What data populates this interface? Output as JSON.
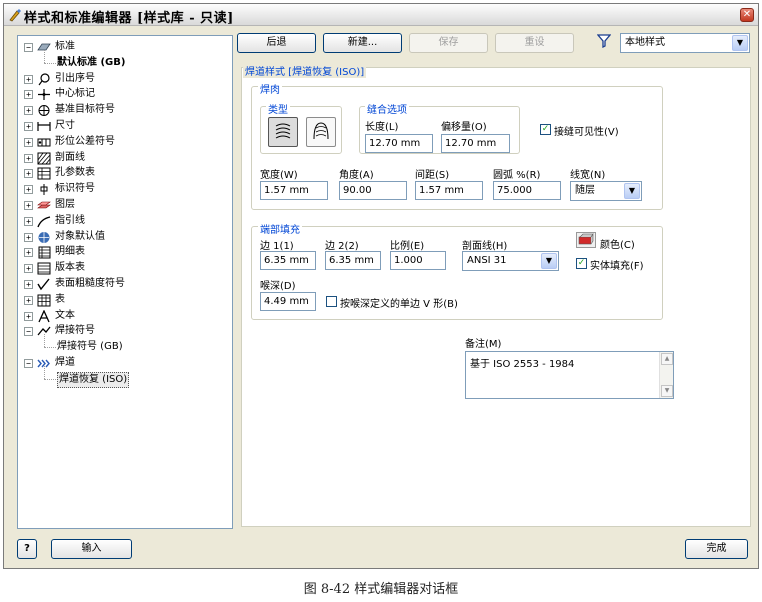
{
  "window": {
    "title": "样式和标准编辑器 [样式库 - 只读]"
  },
  "toolbar": {
    "back": "后退",
    "new": "新建...",
    "save": "保存",
    "reset": "重设",
    "filter_value": "本地样式"
  },
  "tree": [
    {
      "label": "标准",
      "exp": "−",
      "indent": 0,
      "icon": "standard"
    },
    {
      "label": "默认标准 (GB)",
      "exp": "",
      "indent": 1,
      "icon": "",
      "bold": true
    },
    {
      "label": "引出序号",
      "exp": "+",
      "indent": 0,
      "icon": "balloon"
    },
    {
      "label": "中心标记",
      "exp": "+",
      "indent": 0,
      "icon": "center-mark"
    },
    {
      "label": "基准目标符号",
      "exp": "+",
      "indent": 0,
      "icon": "datum-target"
    },
    {
      "label": "尺寸",
      "exp": "+",
      "indent": 0,
      "icon": "dimension"
    },
    {
      "label": "形位公差符号",
      "exp": "+",
      "indent": 0,
      "icon": "gdt"
    },
    {
      "label": "剖面线",
      "exp": "+",
      "indent": 0,
      "icon": "hatch"
    },
    {
      "label": "孔参数表",
      "exp": "+",
      "indent": 0,
      "icon": "hole-table"
    },
    {
      "label": "标识符号",
      "exp": "+",
      "indent": 0,
      "icon": "id-symbol"
    },
    {
      "label": "图层",
      "exp": "+",
      "indent": 0,
      "icon": "layers"
    },
    {
      "label": "指引线",
      "exp": "+",
      "indent": 0,
      "icon": "leader"
    },
    {
      "label": "对象默认值",
      "exp": "+",
      "indent": 0,
      "icon": "object-defaults"
    },
    {
      "label": "明细表",
      "exp": "+",
      "indent": 0,
      "icon": "parts-list"
    },
    {
      "label": "版本表",
      "exp": "+",
      "indent": 0,
      "icon": "revision-table"
    },
    {
      "label": "表面粗糙度符号",
      "exp": "+",
      "indent": 0,
      "icon": "surface-texture"
    },
    {
      "label": "表",
      "exp": "+",
      "indent": 0,
      "icon": "table"
    },
    {
      "label": "文本",
      "exp": "+",
      "indent": 0,
      "icon": "text"
    },
    {
      "label": "焊接符号",
      "exp": "−",
      "indent": 0,
      "icon": "weld-symbol"
    },
    {
      "label": "焊接符号 (GB)",
      "exp": "",
      "indent": 1,
      "icon": ""
    },
    {
      "label": "焊道",
      "exp": "−",
      "indent": 0,
      "icon": "weld-bead"
    },
    {
      "label": "焊道恢复 (ISO)",
      "exp": "",
      "indent": 1,
      "icon": "",
      "selected": true
    }
  ],
  "panel": {
    "title": "焊道样式 [焊道恢复 (ISO)]"
  },
  "weld": {
    "group": "焊肉",
    "type_group": "类型",
    "stitch_group": "缝合选项",
    "length_label": "长度(L)",
    "length_value": "12.70 mm",
    "offset_label": "偏移量(O)",
    "offset_value": "12.70 mm",
    "visible_label": "接缝可见性(V)",
    "visible_checked": true,
    "width_label": "宽度(W)",
    "width_value": "1.57 mm",
    "angle_label": "角度(A)",
    "angle_value": "90.00",
    "spacing_label": "间距(S)",
    "spacing_value": "1.57 mm",
    "arc_label": "圆弧 %(R)",
    "arc_value": "75.000",
    "linewidth_label": "线宽(N)",
    "linewidth_value": "随层"
  },
  "endfill": {
    "group": "端部填充",
    "side1_label": "边 1(1)",
    "side1_value": "6.35 mm",
    "side2_label": "边 2(2)",
    "side2_value": "6.35 mm",
    "ratio_label": "比例(E)",
    "ratio_value": "1.000",
    "hatch_label": "剖面线(H)",
    "hatch_value": "ANSI 31",
    "color_label": "颜色(C)",
    "solid_label": "实体填充(F)",
    "solid_checked": true,
    "depth_label": "喉深(D)",
    "depth_value": "4.49 mm",
    "vshape_label": "按喉深定义的单边 V 形(B)",
    "vshape_checked": false
  },
  "notes": {
    "label": "备注(M)",
    "value": "基于 ISO 2553 - 1984"
  },
  "footer": {
    "help": "?",
    "import": "输入",
    "done": "完成"
  },
  "caption": "图 8-42  样式编辑器对话框"
}
